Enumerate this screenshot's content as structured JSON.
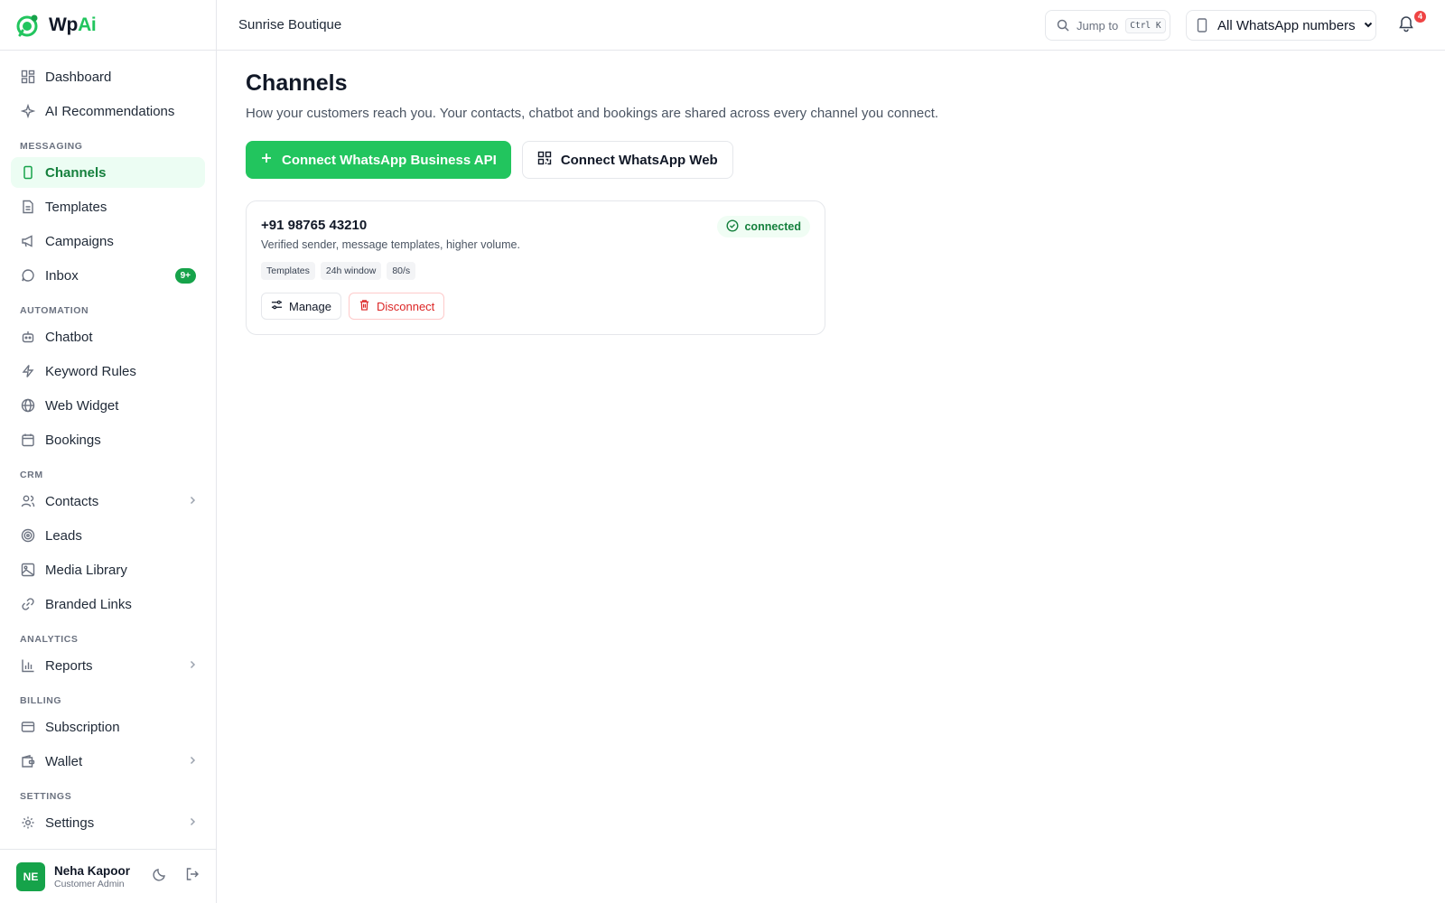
{
  "brand": {
    "name_main": "Wp",
    "name_accent": "Ai",
    "accent_color": "#22c55e"
  },
  "sidebar": {
    "top_items": [
      {
        "label": "Dashboard",
        "icon": "dashboard-icon"
      },
      {
        "label": "AI Recommendations",
        "icon": "sparkles-icon"
      }
    ],
    "sections": [
      {
        "label": "MESSAGING",
        "items": [
          {
            "label": "Channels",
            "icon": "phone-icon",
            "active": true
          },
          {
            "label": "Templates",
            "icon": "document-icon"
          },
          {
            "label": "Campaigns",
            "icon": "megaphone-icon"
          },
          {
            "label": "Inbox",
            "icon": "chat-bubble-icon",
            "badge": "9+"
          }
        ]
      },
      {
        "label": "AUTOMATION",
        "items": [
          {
            "label": "Chatbot",
            "icon": "bot-icon"
          },
          {
            "label": "Keyword Rules",
            "icon": "lightning-icon"
          },
          {
            "label": "Web Widget",
            "icon": "globe-icon"
          },
          {
            "label": "Bookings",
            "icon": "calendar-icon"
          }
        ]
      },
      {
        "label": "CRM",
        "items": [
          {
            "label": "Contacts",
            "icon": "users-icon",
            "expandable": true
          },
          {
            "label": "Leads",
            "icon": "target-icon"
          },
          {
            "label": "Media Library",
            "icon": "image-icon"
          },
          {
            "label": "Branded Links",
            "icon": "link-icon"
          }
        ]
      },
      {
        "label": "ANALYTICS",
        "items": [
          {
            "label": "Reports",
            "icon": "bar-chart-icon",
            "expandable": true
          }
        ]
      },
      {
        "label": "BILLING",
        "items": [
          {
            "label": "Subscription",
            "icon": "credit-card-icon"
          },
          {
            "label": "Wallet",
            "icon": "wallet-icon",
            "expandable": true
          }
        ]
      },
      {
        "label": "SETTINGS",
        "items": [
          {
            "label": "Settings",
            "icon": "gear-icon",
            "expandable": true
          }
        ]
      }
    ]
  },
  "user": {
    "initials": "NE",
    "name": "Neha Kapoor",
    "role": "Customer Admin"
  },
  "topbar": {
    "workspace": "Sunrise Boutique",
    "jump_label": "Jump to",
    "jump_shortcut": "Ctrl K",
    "number_select": "All WhatsApp numbers",
    "notification_count": "4"
  },
  "main": {
    "title": "Channels",
    "subtitle": "How your customers reach you. Your contacts, chatbot and bookings are shared across every channel you connect.",
    "primary_button": "Connect WhatsApp Business API",
    "secondary_button": "Connect WhatsApp Web",
    "channel": {
      "phone": "+91 98765 43210",
      "description": "Verified sender, message templates, higher volume.",
      "status": "connected",
      "tags": [
        "Templates",
        "24h window",
        "80/s"
      ],
      "manage_label": "Manage",
      "disconnect_label": "Disconnect"
    }
  }
}
